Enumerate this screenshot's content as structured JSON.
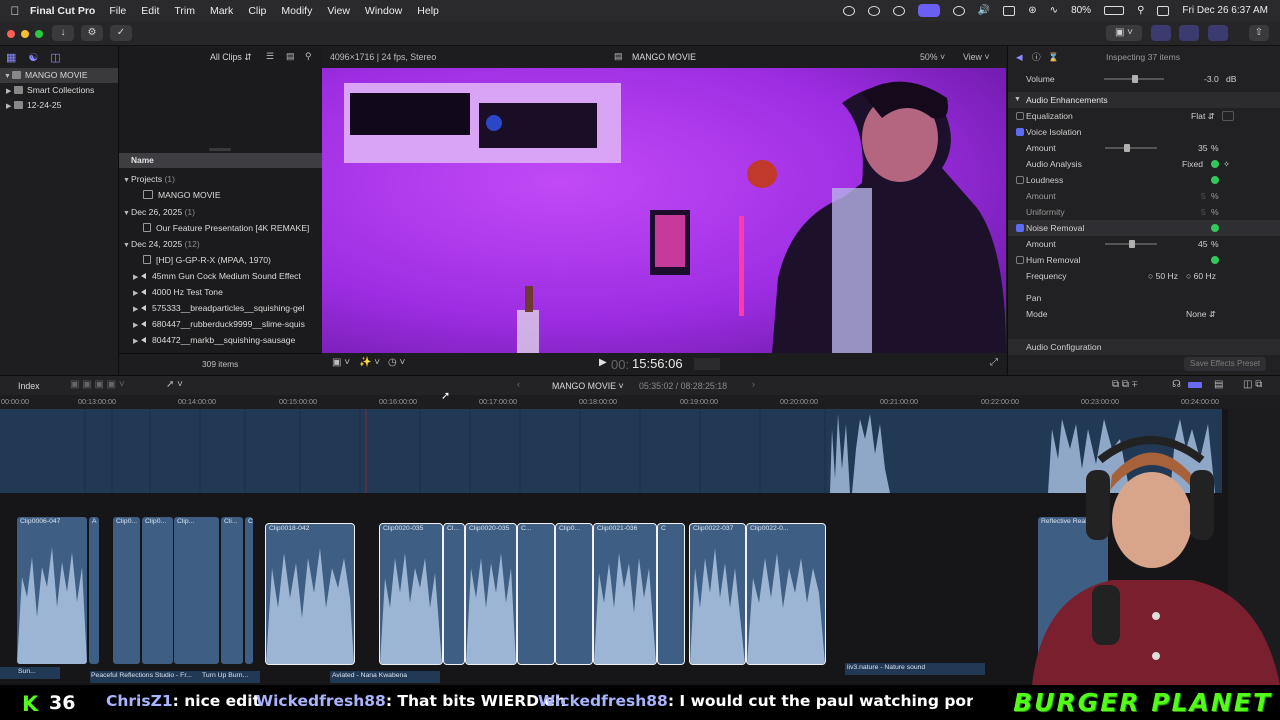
{
  "menubar": {
    "app_name": "Final Cut Pro",
    "menus": [
      "File",
      "Edit",
      "Trim",
      "Mark",
      "Clip",
      "Modify",
      "View",
      "Window",
      "Help"
    ],
    "battery": "80%",
    "datetime": "Fri Dec 26  6:37 AM"
  },
  "libraries": {
    "items": [
      {
        "label": "MANGO MOVIE",
        "expanded": true,
        "selected": true
      },
      {
        "label": "Smart Collections",
        "expanded": false
      },
      {
        "label": "12-24-25",
        "expanded": false
      }
    ]
  },
  "browser": {
    "filter": "All Clips",
    "column_header": "Name",
    "item_count": "309 items",
    "groups": [
      {
        "label": "Projects",
        "count": "(1)",
        "items": [
          "MANGO MOVIE"
        ]
      },
      {
        "label": "Dec 26, 2025",
        "count": "(1)",
        "items": [
          "Our Feature Presentation [4K REMAKE]"
        ]
      },
      {
        "label": "Dec 24, 2025",
        "count": "(12)",
        "items": [
          "[HD] G-GP-R-X (MPAA, 1970)",
          "45mm Gun Cock Medium Sound Effect",
          "4000 Hz Test Tone",
          "575333__breadparticles__squishing-gel",
          "680447__rubberduck9999__slime-squis",
          "804472__markb__squishing-sausage"
        ]
      }
    ]
  },
  "viewer": {
    "format": "4096×1716 | 24 fps, Stereo",
    "project_title": "MANGO MOVIE",
    "zoom": "50%",
    "view_menu": "View",
    "timecode": "15:56:06",
    "timecode_prefix": "00:"
  },
  "inspector": {
    "header": "Inspecting 37 items",
    "volume_label": "Volume",
    "volume_value": "-3.0",
    "volume_unit": "dB",
    "section_enhancements": "Audio Enhancements",
    "equalization_label": "Equalization",
    "equalization_value": "Flat",
    "voice_isolation_label": "Voice Isolation",
    "amount_label": "Amount",
    "voice_amount": "35",
    "analysis_label": "Audio Analysis",
    "analysis_value": "Fixed",
    "loudness_label": "Loudness",
    "uniformity_label": "Uniformity",
    "loudness_amount": "5",
    "uniformity_amount": "5",
    "noise_label": "Noise Removal",
    "noise_amount": "45",
    "hum_label": "Hum Removal",
    "frequency_label": "Frequency",
    "freq_50": "50",
    "freq_60": "60",
    "hz": "Hz",
    "percent": "%",
    "pan_label": "Pan",
    "mode_label": "Mode",
    "mode_value": "None",
    "audio_config": "Audio Configuration",
    "save_preset": "Save Effects Preset"
  },
  "timeline": {
    "index_label": "Index",
    "project_name": "MANGO MOVIE",
    "duration": "05:35:02 / 08:28:25:18",
    "ruler_labels": [
      "00:00:00",
      "00:13:00:00",
      "00:14:00:00",
      "00:15:00:00",
      "00:16:00:00",
      "00:17:00:00",
      "00:18:00:00",
      "00:19:00:00",
      "00:20:00:00",
      "00:21:00:00",
      "00:22:00:00",
      "00:23:00:00",
      "00:24:00:00"
    ],
    "clips": [
      "Clip0006-047",
      "A",
      "Clip0...",
      "Clip0...",
      "Clip...",
      "C...",
      "Cli...",
      "C",
      "C",
      "Clip0018-042",
      "Clip0020-035",
      "Cl...",
      "Clip0020-035",
      "C...",
      "C",
      "Clip0...",
      "Clip0021-036",
      "C",
      "C",
      "Clip0022-037",
      "Clip0022-0...",
      "C"
    ],
    "right_clip": "Reflective Realm",
    "audio_labels": [
      "Sun...",
      "Peaceful Reflections Studio - Fr...",
      "Turn Up Burn...",
      "Aviated - Nana Kwabena",
      "liv3.nature - Nature sound"
    ]
  },
  "overlay": {
    "kick_logo": "K",
    "count": "36",
    "chats": [
      {
        "user": "ChrisZ1",
        "message": ": nice edit"
      },
      {
        "user": "Wickedfresh88",
        "message": ": That bits WIERD eh"
      },
      {
        "user": "Wickedfresh88",
        "message": ": I would cut the paul watching porn a little"
      }
    ],
    "brand": "BURGER PLANET"
  },
  "colors": {
    "accent": "#5c6cf5",
    "video_purple": "#a12ee6",
    "clip_blue": "#3f5e83",
    "kick_green": "#53fc18"
  }
}
